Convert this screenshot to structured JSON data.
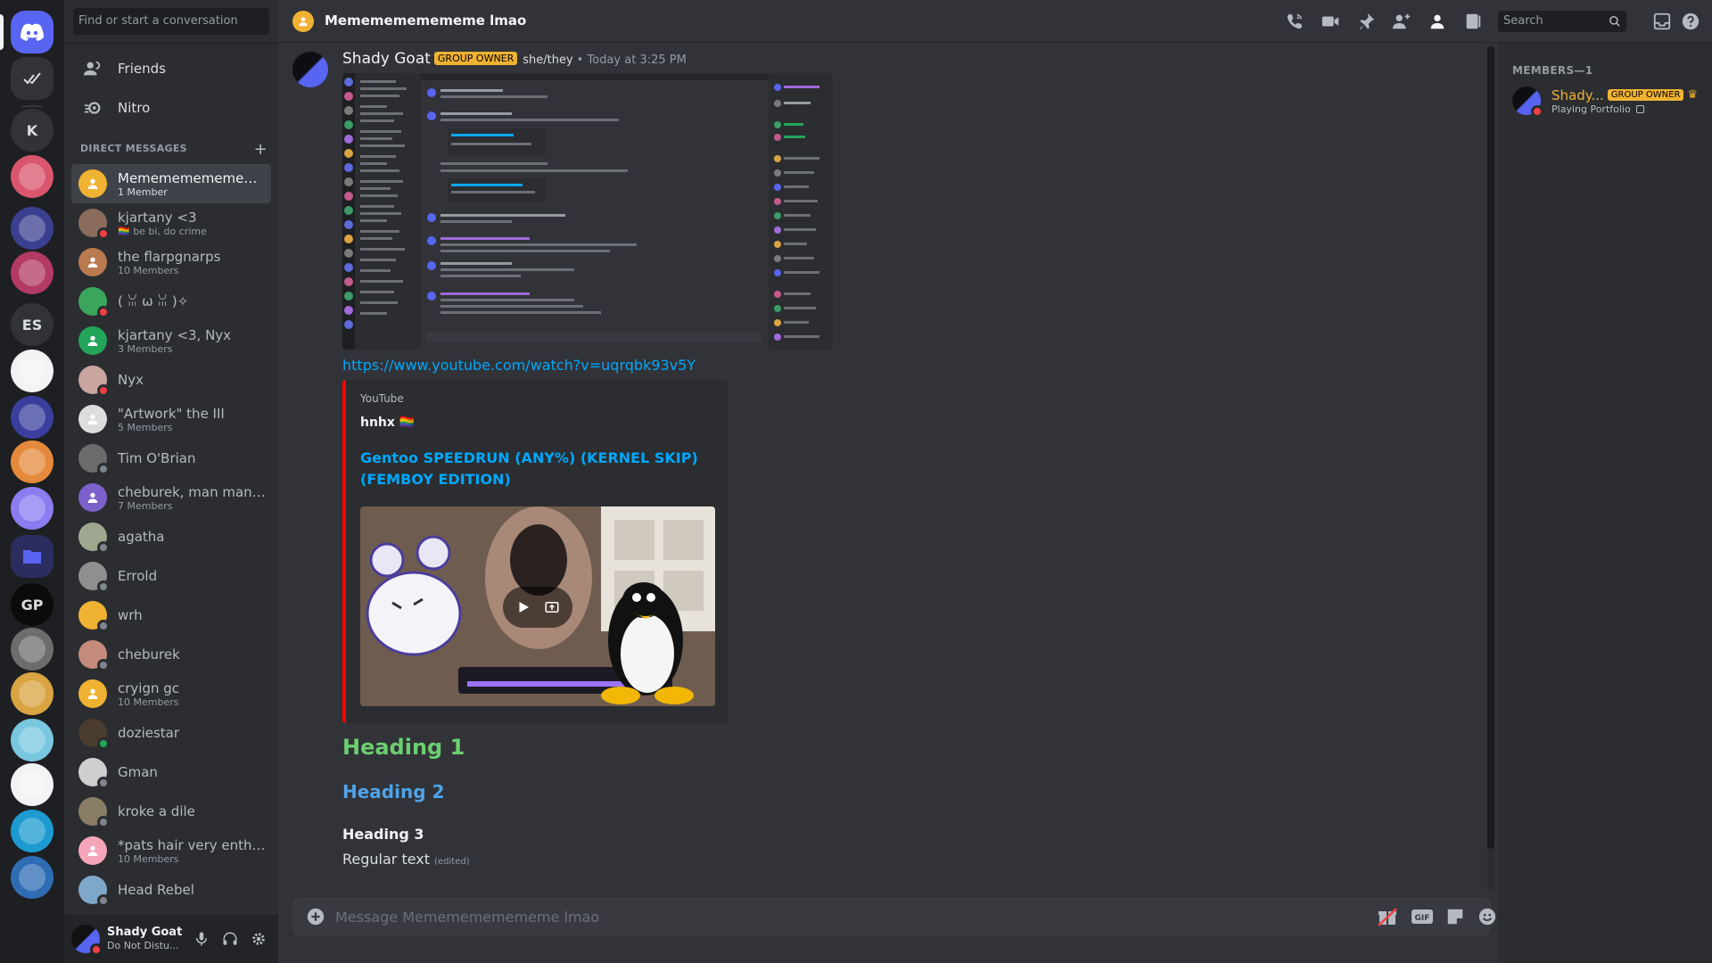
{
  "sidebar": {
    "search_placeholder": "Find or start a conversation",
    "nav": [
      {
        "label": "Friends",
        "icon": "friends-icon"
      },
      {
        "label": "Nitro",
        "icon": "nitro-icon"
      }
    ],
    "dm_header": "DIRECT MESSAGES",
    "dms": [
      {
        "name": "Mememememememe...",
        "sub": "1 Member",
        "avatar": "#f0b232",
        "status": "",
        "active": true
      },
      {
        "name": "kjartany <3",
        "sub": "🏳️‍🌈 be bi, do crime",
        "avatar": "#8a6b5c",
        "status": "#f23f43"
      },
      {
        "name": "the flarpgnarps",
        "sub": "10 Members",
        "avatar": "#b97a4f",
        "status": ""
      },
      {
        "name": "( ꈍ ω ꈍ )✧",
        "sub": "",
        "avatar": "#3ba55c",
        "status": "#f23f43"
      },
      {
        "name": "kjartany <3, Nyx",
        "sub": "3 Members",
        "avatar": "#23a559",
        "status": ""
      },
      {
        "name": "Nyx",
        "sub": "",
        "avatar": "#c9a6a0",
        "status": "#f23f43"
      },
      {
        "name": "\"Artwork\" the III",
        "sub": "5 Members",
        "avatar": "#dddddd",
        "status": ""
      },
      {
        "name": "Tim O'Brian",
        "sub": "",
        "avatar": "#6b6b6b",
        "status": "#80848e"
      },
      {
        "name": "cheburek, man man, E...",
        "sub": "7 Members",
        "avatar": "#7b61c9",
        "status": ""
      },
      {
        "name": "agatha",
        "sub": "",
        "avatar": "#a0a78f",
        "status": "#80848e"
      },
      {
        "name": "Errold",
        "sub": "",
        "avatar": "#8f8f8f",
        "status": "#80848e"
      },
      {
        "name": "wrh",
        "sub": "",
        "avatar": "#f0b232",
        "status": "#80848e"
      },
      {
        "name": "cheburek",
        "sub": "",
        "avatar": "#c48b7c",
        "status": "#80848e"
      },
      {
        "name": "cryign gc",
        "sub": "10 Members",
        "avatar": "#f0b232",
        "status": ""
      },
      {
        "name": "doziestar",
        "sub": "",
        "avatar": "#4a3b2f",
        "status": "#23a559"
      },
      {
        "name": "Gman",
        "sub": "",
        "avatar": "#cfcfcf",
        "status": "#80848e"
      },
      {
        "name": "kroke a dile",
        "sub": "",
        "avatar": "#8a7d66",
        "status": "#80848e"
      },
      {
        "name": "*pats hair very enthus...",
        "sub": "10 Members",
        "avatar": "#f4a6b8",
        "status": ""
      },
      {
        "name": "Head Rebel",
        "sub": "",
        "avatar": "#7fa7c9",
        "status": "#80848e"
      }
    ]
  },
  "rail": {
    "items": [
      {
        "label": "",
        "icon": "discord-logo-icon",
        "bg": "#5865f2"
      },
      {
        "label": "",
        "icon": "check-icon",
        "bg": "#313338"
      },
      {
        "label": "K",
        "icon": "",
        "bg": "#313338"
      },
      {
        "label": "",
        "icon": "server-avatar-icon",
        "bg": "#d9566e"
      },
      {
        "label": "",
        "icon": "server-avatar-icon",
        "bg": "#3b3f8f"
      },
      {
        "label": "",
        "icon": "server-avatar-icon",
        "bg": "#b23a64"
      },
      {
        "label": "ES",
        "icon": "",
        "bg": "#313338"
      },
      {
        "label": "",
        "icon": "server-avatar-icon",
        "bg": "#f2f3f5"
      },
      {
        "label": "",
        "icon": "server-avatar-icon",
        "bg": "#3a3f9e"
      },
      {
        "label": "",
        "icon": "server-avatar-icon",
        "bg": "#e58a3c"
      },
      {
        "label": "",
        "icon": "server-avatar-icon",
        "bg": "#8b7cf0"
      },
      {
        "label": "",
        "icon": "folder-icon",
        "bg": "#2b2d60"
      },
      {
        "label": "GP",
        "icon": "",
        "bg": "#0b0b0b"
      },
      {
        "label": "",
        "icon": "server-avatar-icon",
        "bg": "#6d6d6d"
      },
      {
        "label": "",
        "icon": "server-avatar-icon",
        "bg": "#d9a441"
      },
      {
        "label": "",
        "icon": "server-avatar-icon",
        "bg": "#79c8e0"
      },
      {
        "label": "",
        "icon": "server-avatar-icon",
        "bg": "#f2f3f5"
      },
      {
        "label": "",
        "icon": "server-avatar-icon",
        "bg": "#1d9bd1"
      },
      {
        "label": "",
        "icon": "server-avatar-icon",
        "bg": "#2e6db4"
      }
    ]
  },
  "user_panel": {
    "name": "Shady Goat",
    "status": "Do Not Distu..."
  },
  "header": {
    "title": "Mememememememe lmao",
    "search_placeholder": "Search"
  },
  "message": {
    "author": "Shady Goat",
    "owner_tag": "GROUP OWNER",
    "pronouns": "she/they",
    "timestamp": "Today at 3:25 PM",
    "link": "https://www.youtube.com/watch?v=uqrqbk93v5Y",
    "embed": {
      "provider": "YouTube",
      "author": "hnhx 🏳️‍🌈",
      "title": "Gentoo SPEEDRUN (ANY%) (KERNEL SKIP) (FEMBOY EDITION)"
    },
    "heading1": "Heading 1",
    "heading2": "Heading 2",
    "heading3": "Heading 3",
    "regular": "Regular text",
    "edited": "(edited)"
  },
  "composer": {
    "placeholder": "Message Mememememememe lmao"
  },
  "members": {
    "header": "MEMBERS—1",
    "list": [
      {
        "name": "Shady...",
        "tag": "GROUP OWNER",
        "activity": "Playing Portfolio"
      }
    ]
  },
  "colors": {
    "accent": "#5865f2",
    "link": "#00a8fc",
    "owner": "#f0b232",
    "dnd": "#f23f43",
    "online": "#23a559"
  }
}
